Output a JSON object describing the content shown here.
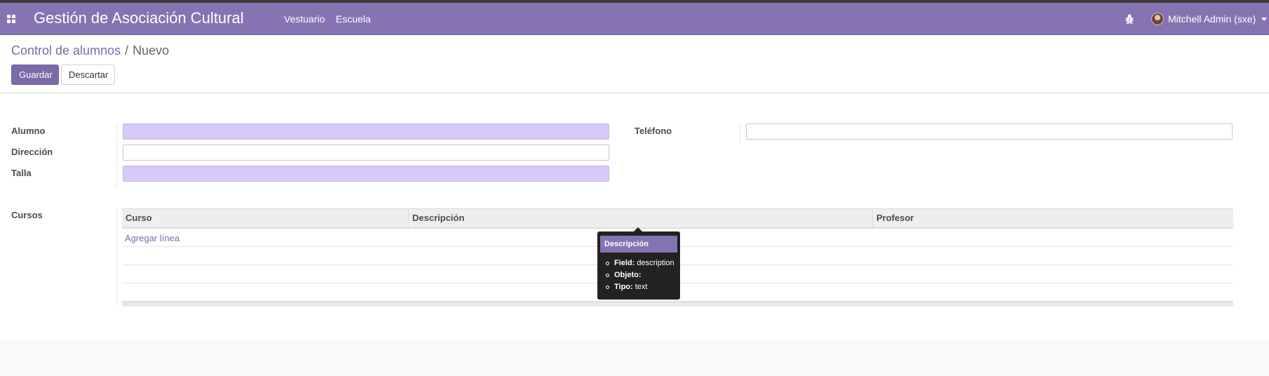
{
  "navbar": {
    "app_title": "Gestión de Asociación Cultural",
    "menu": [
      "Vestuario",
      "Escuela"
    ],
    "user_name": "Mitchell Admin (sxe)",
    "icons": [
      "apps-icon",
      "bug-icon",
      "avatar",
      "caret-down-icon"
    ],
    "color": "#8574b1"
  },
  "breadcrumb": {
    "parent": "Control de alumnos",
    "separator": "/",
    "current": "Nuevo"
  },
  "buttons": {
    "save": "Guardar",
    "discard": "Descartar"
  },
  "form": {
    "alumno_label": "Alumno",
    "alumno_value": "",
    "direccion_label": "Dirección",
    "direccion_value": "",
    "talla_label": "Talla",
    "talla_value": "",
    "telefono_label": "Teléfono",
    "telefono_value": "",
    "cursos_label": "Cursos",
    "required_color": "#d8c9fb"
  },
  "cursos_table": {
    "columns": [
      "Curso",
      "Descripción",
      "Profesor"
    ],
    "add_line": "Agregar línea",
    "rows": []
  },
  "tooltip": {
    "title": "Descripción",
    "items": [
      {
        "key": "Field:",
        "value": "description"
      },
      {
        "key": "Objeto:",
        "value": ""
      },
      {
        "key": "Tipo:",
        "value": "text"
      }
    ]
  }
}
